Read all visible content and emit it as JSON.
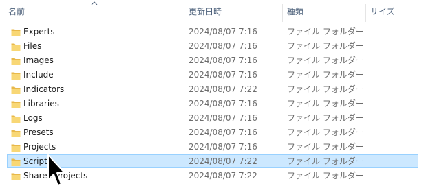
{
  "header": {
    "columns": [
      {
        "label": "名前"
      },
      {
        "label": "更新日時"
      },
      {
        "label": "種類"
      },
      {
        "label": "サイズ"
      }
    ],
    "sort_indicator": "sort-ascending-icon"
  },
  "rows": [
    {
      "name": "Experts",
      "date": "2024/08/07 7:16",
      "type": "ファイル フォルダー",
      "selected": false
    },
    {
      "name": "Files",
      "date": "2024/08/07 7:16",
      "type": "ファイル フォルダー",
      "selected": false
    },
    {
      "name": "Images",
      "date": "2024/08/07 7:16",
      "type": "ファイル フォルダー",
      "selected": false
    },
    {
      "name": "Include",
      "date": "2024/08/07 7:16",
      "type": "ファイル フォルダー",
      "selected": false
    },
    {
      "name": "Indicators",
      "date": "2024/08/07 7:22",
      "type": "ファイル フォルダー",
      "selected": false
    },
    {
      "name": "Libraries",
      "date": "2024/08/07 7:16",
      "type": "ファイル フォルダー",
      "selected": false
    },
    {
      "name": "Logs",
      "date": "2024/08/07 7:16",
      "type": "ファイル フォルダー",
      "selected": false
    },
    {
      "name": "Presets",
      "date": "2024/08/07 7:16",
      "type": "ファイル フォルダー",
      "selected": false
    },
    {
      "name": "Projects",
      "date": "2024/08/07 7:16",
      "type": "ファイル フォルダー",
      "selected": false
    },
    {
      "name": "Scripts",
      "date": "2024/08/07 7:22",
      "type": "ファイル フォルダー",
      "selected": true
    },
    {
      "name": "Shared Projects",
      "date": "2024/08/07 7:22",
      "type": "ファイル フォルダー",
      "selected": false
    }
  ],
  "colors": {
    "selection_bg": "#cce8ff",
    "selection_border": "#99d1ff",
    "folder": "#f8d775",
    "header_text": "#4c607a"
  },
  "icons": {
    "row_icon": "folder-icon",
    "pointer": "mouse-cursor-icon"
  }
}
